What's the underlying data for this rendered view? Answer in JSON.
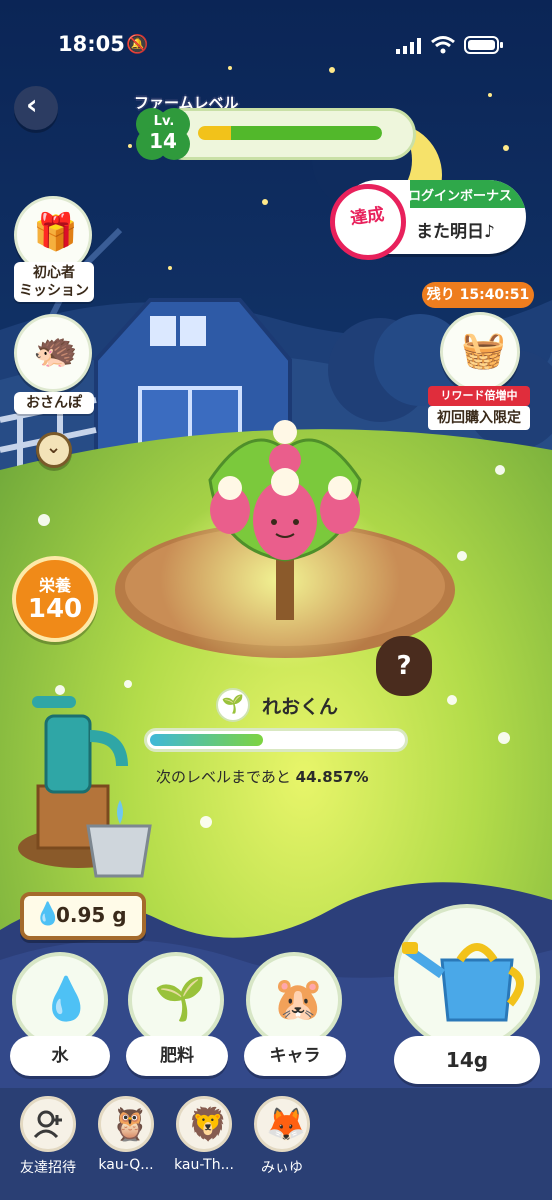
{
  "status_bar": {
    "time": "18:05"
  },
  "farm": {
    "title": "ファームレベル",
    "level_prefix": "Lv.",
    "level": "14",
    "level_progress": 0.18
  },
  "left_menu": {
    "beginner_mission_line1": "初心者",
    "beginner_mission_line2": "ミッション",
    "walk": "おさんぽ"
  },
  "login_bonus": {
    "title": "ログインボーナス",
    "subtitle": "また明日♪",
    "stamp": "達成"
  },
  "shop": {
    "timer": "残り 15:40:51",
    "badge": "リワード倍増中",
    "label": "初回購入限定"
  },
  "nutrition": {
    "label": "栄養",
    "value": "140"
  },
  "plant": {
    "name": "れおくん",
    "progress_percent": 44.857,
    "next_level_prefix": "次のレベルまであと",
    "next_level_value": "44.857%"
  },
  "water_gauge": {
    "value": "0.95 g"
  },
  "actions": {
    "water": "水",
    "fertilizer": "肥料",
    "character": "キャラ",
    "watering_can": "14g"
  },
  "friends": [
    {
      "name": "友達招待",
      "icon": "add-friend-icon"
    },
    {
      "name": "kau-Q...",
      "icon": "owl-avatar"
    },
    {
      "name": "kau-Th...",
      "icon": "lion-avatar"
    },
    {
      "name": "みぃゆ",
      "icon": "fox-avatar"
    }
  ],
  "colors": {
    "sky": "#0d2b5a",
    "grass": "#a8d64a",
    "accent_green": "#2fa84a",
    "accent_orange": "#f08a18",
    "stamp_pink": "#e8215c"
  }
}
